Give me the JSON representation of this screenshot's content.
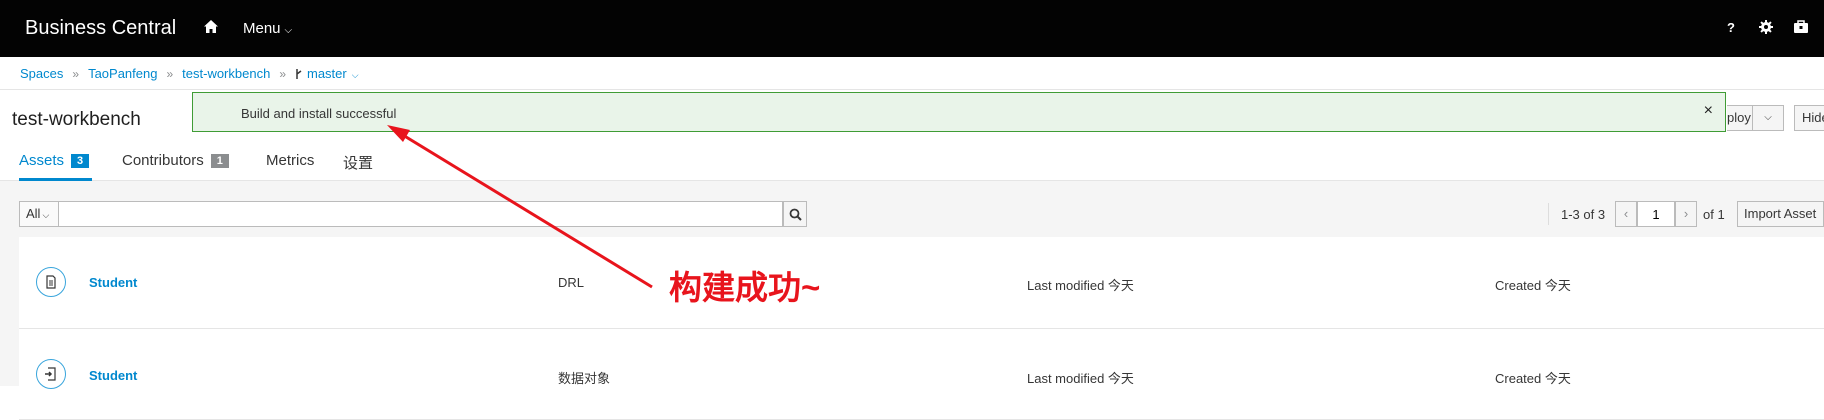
{
  "app": {
    "brand": "Business Central",
    "menu_label": "Menu",
    "top_icons": [
      "help-icon",
      "gear-icon",
      "briefcase-icon"
    ],
    "top_help": "?"
  },
  "breadcrumbs": {
    "items": [
      "Spaces",
      "TaoPanfeng",
      "test-workbench",
      "master"
    ],
    "separator": "»"
  },
  "project": {
    "title": "test-workbench",
    "deploy_label": "ploy",
    "hide_label": "Hide"
  },
  "alert": {
    "message": "Build and install successful",
    "close": "×",
    "border_color": "#3f9c35",
    "background": "#e9f4e9"
  },
  "tabs": [
    {
      "label": "Assets",
      "badge": "3",
      "active": true
    },
    {
      "label": "Contributors",
      "badge": "1",
      "active": false
    },
    {
      "label": "Metrics",
      "badge": "",
      "active": false
    },
    {
      "label": "设置",
      "badge": "",
      "active": false
    }
  ],
  "toolbar": {
    "filter_value": "All",
    "search_value": "",
    "search_placeholder": "",
    "page_count": "1-3 of 3",
    "prev": "‹",
    "page_value": "1",
    "next": "›",
    "page_total": "of 1",
    "import_label": "Import Asset"
  },
  "assets": [
    {
      "name": "Student",
      "type": "DRL",
      "icon": "document-icon",
      "modified": "Last modified 今天",
      "created": "Created 今天"
    },
    {
      "name": "Student",
      "type": "数据对象",
      "icon": "data-object-icon",
      "modified": "Last modified 今天",
      "created": "Created 今天"
    }
  ],
  "annotation": {
    "text": "构建成功~",
    "color": "#e8141c"
  },
  "colors": {
    "accent": "#0088ce",
    "topbar": "#030303"
  }
}
